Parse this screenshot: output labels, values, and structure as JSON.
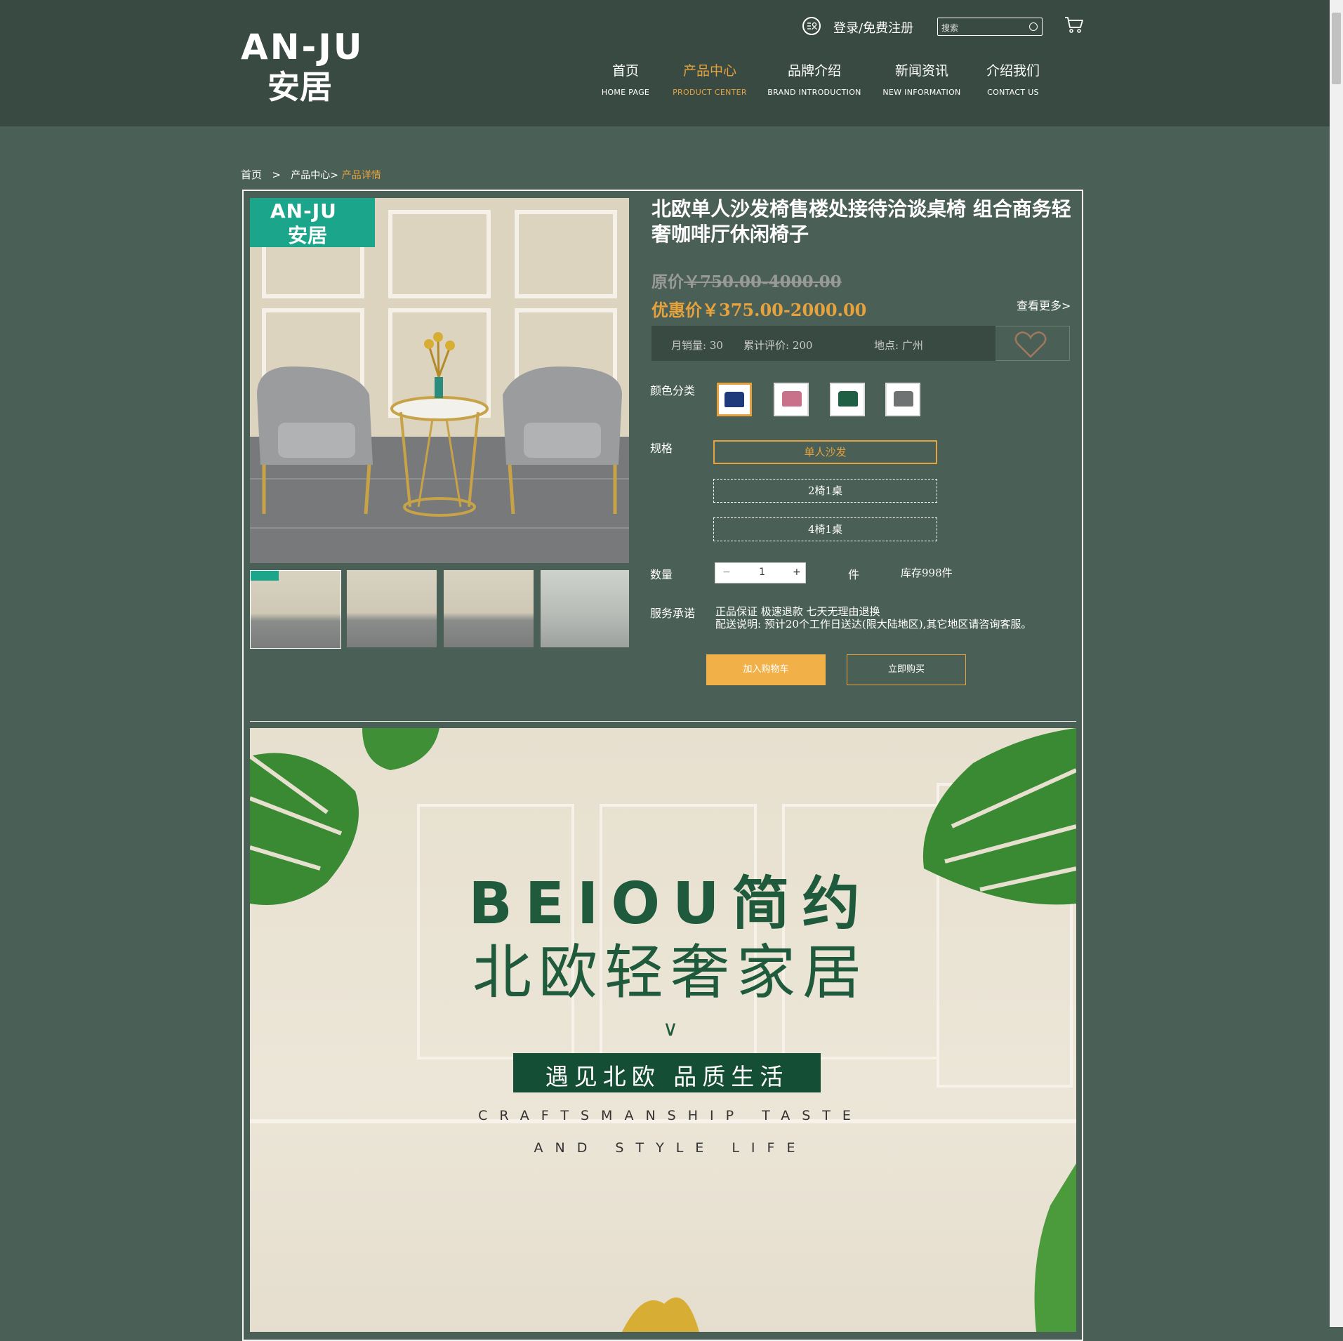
{
  "header": {
    "logo_en": "AN-JU",
    "logo_cn": "安居",
    "login_label": "登录/免费注册",
    "search_placeholder": "搜索",
    "nav": [
      {
        "cn": "首页",
        "en": "HOME   PAGE"
      },
      {
        "cn": "产品中心",
        "en": "PRODUCT   CENTER"
      },
      {
        "cn": "品牌介绍",
        "en": "BRAND   INTRODUCTION"
      },
      {
        "cn": "新闻资讯",
        "en": "NEW   INFORMATION"
      },
      {
        "cn": "介绍我们",
        "en": "CONTACT   US"
      }
    ],
    "active_nav": 1
  },
  "breadcrumb": {
    "home": "首页",
    "sep": ">",
    "category": "产品中心>",
    "current": "产品详情"
  },
  "product": {
    "badge_en": "AN-JU",
    "badge_cn": "安居",
    "title": "北欧单人沙发椅售楼处接待洽谈桌椅 组合商务轻奢咖啡厅休闲椅子",
    "orig_label": "原价",
    "orig_price": "￥750.00-4000.00",
    "sale_label": "优惠价",
    "sale_price": "￥375.00-2000.00",
    "view_more": "查看更多>",
    "monthly_sales": "月销量: 30",
    "reviews": "累计评价: 200",
    "location": "地点: 广州",
    "color_label": "颜色分类",
    "colors": [
      "#1f3a7a",
      "#c9708a",
      "#1f5f44",
      "#6f7273"
    ],
    "spec_label": "规格",
    "specs": [
      "单人沙发",
      "2椅1桌",
      "4椅1桌"
    ],
    "qty_label": "数量",
    "qty_minus": "−",
    "qty_value": "1",
    "qty_plus": "+",
    "unit": "件",
    "stock": "库存998件",
    "service_label": "服务承诺",
    "service_line1": "正品保证 极速退款 七天无理由退换",
    "service_line2": "配送说明: 预计20个工作日送达(限大陆地区),其它地区请咨询客服。",
    "add_cart": "加入购物车",
    "buy_now": "立即购买"
  },
  "banner": {
    "line1": "BEIOU简约",
    "line2": "北欧轻奢家居",
    "chevron": "∨",
    "strip": "遇见北欧  品质生活",
    "en1": "CRAFTSMANSHIP  TASTE",
    "en2": "AND  STYLE  LIFE"
  },
  "colors": {
    "accent": "#e6a23c",
    "header_bg": "#394a42",
    "page_bg": "#4a5f56",
    "brand_green": "#1ba58a"
  }
}
